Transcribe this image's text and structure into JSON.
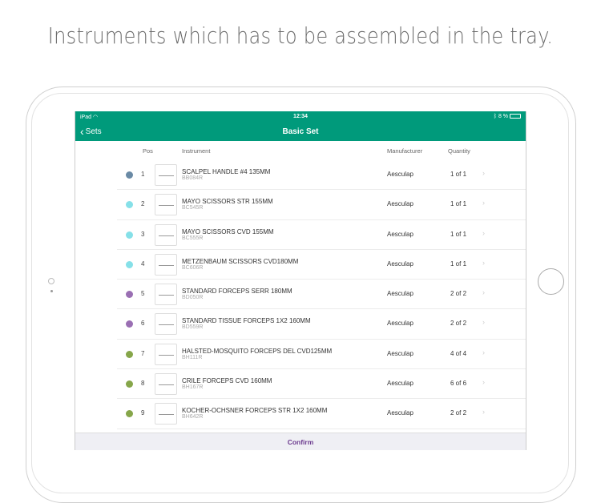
{
  "caption": "Instruments which has to be assembled in the tray.",
  "status": {
    "device": "iPad",
    "time": "12:34",
    "battery": "8 %"
  },
  "nav": {
    "back": "Sets",
    "title": "Basic Set"
  },
  "columns": {
    "pos": "Pos",
    "instrument": "Instrument",
    "manufacturer": "Manufacturer",
    "quantity": "Quantity"
  },
  "rows": [
    {
      "color": "#6a8aa5",
      "pos": "1",
      "name": "SCALPEL HANDLE #4 135MM",
      "code": "BB084R",
      "mfr": "Aesculap",
      "qty": "1 of 1"
    },
    {
      "color": "#86e0e8",
      "pos": "2",
      "name": "MAYO SCISSORS STR 155MM",
      "code": "BC545R",
      "mfr": "Aesculap",
      "qty": "1 of 1"
    },
    {
      "color": "#86e0e8",
      "pos": "3",
      "name": "MAYO SCISSORS CVD 155MM",
      "code": "BC555R",
      "mfr": "Aesculap",
      "qty": "1 of 1"
    },
    {
      "color": "#86e0e8",
      "pos": "4",
      "name": "METZENBAUM SCISSORS CVD180MM",
      "code": "BC606R",
      "mfr": "Aesculap",
      "qty": "1 of 1"
    },
    {
      "color": "#9a6fb3",
      "pos": "5",
      "name": "STANDARD FORCEPS SERR 180MM",
      "code": "BD050R",
      "mfr": "Aesculap",
      "qty": "2 of 2"
    },
    {
      "color": "#9a6fb3",
      "pos": "6",
      "name": "STANDARD TISSUE FORCEPS 1X2 160MM",
      "code": "BD559R",
      "mfr": "Aesculap",
      "qty": "2 of 2"
    },
    {
      "color": "#86a64a",
      "pos": "7",
      "name": "HALSTED-MOSQUITO FORCEPS DEL CVD125MM",
      "code": "BH111R",
      "mfr": "Aesculap",
      "qty": "4 of 4"
    },
    {
      "color": "#86a64a",
      "pos": "8",
      "name": "CRILE FORCEPS CVD 160MM",
      "code": "BH167R",
      "mfr": "Aesculap",
      "qty": "6 of 6"
    },
    {
      "color": "#86a64a",
      "pos": "9",
      "name": "KOCHER-OCHSNER FORCEPS STR 1X2 160MM",
      "code": "BH642R",
      "mfr": "Aesculap",
      "qty": "2 of 2"
    }
  ],
  "confirm": "Confirm"
}
